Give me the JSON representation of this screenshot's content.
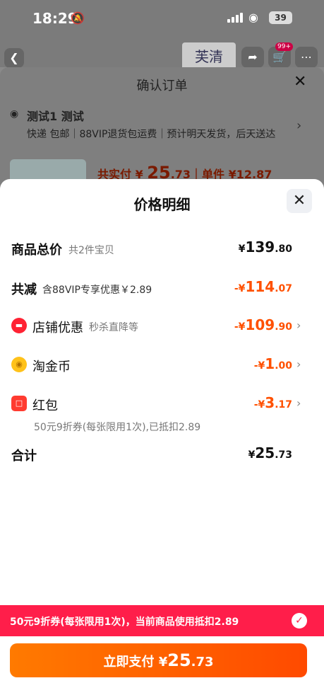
{
  "status_bar": {
    "time": "18:29",
    "battery": "39"
  },
  "nav": {
    "brand": "芙清",
    "cart_badge": "99+"
  },
  "confirm_order": {
    "title": "确认订单",
    "address_name": "测试1 测试",
    "address_info": "快递 包邮｜88VIP退货包运费｜预计明天发货，后天送达",
    "pay_summary_prefix": "共实付 ¥ ",
    "pay_summary_int": "25",
    "pay_summary_dec": ".73",
    "unit_price": "｜单件 ¥12.87"
  },
  "price_detail": {
    "title": "价格明细",
    "goods_total_label": "商品总价",
    "goods_total_sub": "共2件宝贝",
    "goods_total_yen": "¥",
    "goods_total_int": "139",
    "goods_total_dec": ".80",
    "reduce_label": "共减",
    "reduce_sub": "含88VIP专享优惠￥2.89",
    "reduce_yen": "-¥",
    "reduce_int": "114",
    "reduce_dec": ".07",
    "shop_label": "店铺优惠",
    "shop_sub": "秒杀直降等",
    "shop_yen": "-¥",
    "shop_int": "109",
    "shop_dec": ".90",
    "coin_label": "淘金币",
    "coin_yen": "-¥",
    "coin_int": "1",
    "coin_dec": ".00",
    "hongbao_label": "红包",
    "hongbao_yen": "-¥",
    "hongbao_int": "3",
    "hongbao_dec": ".17",
    "coupon_note": "50元9折券(每张限用1次),已抵扣2.89",
    "total_label": "合计",
    "total_yen": "¥",
    "total_int": "25",
    "total_dec": ".73"
  },
  "banner": {
    "text": "50元9折券(每张限用1次)，当前商品使用抵扣2.89"
  },
  "pay_button": {
    "prefix": "立即支付 ¥",
    "int": "25",
    "dec": ".73"
  },
  "colors": {
    "accent": "#ff5000",
    "banner": "#ff1e4a"
  }
}
